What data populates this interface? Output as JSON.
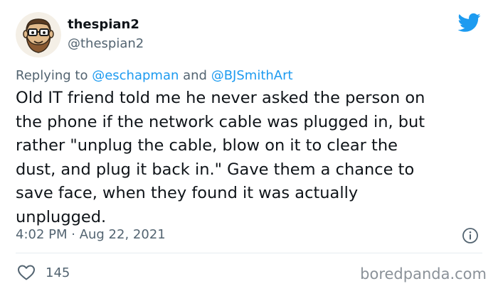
{
  "user": {
    "display_name": "thespian2",
    "handle": "@thespian2"
  },
  "reply": {
    "prefix": "Replying to ",
    "mention1": "@eschapman",
    "joiner": " and ",
    "mention2": "@BJSmithArt"
  },
  "tweet": {
    "text": "Old IT friend told me he never asked the person on\nthe phone if the network cable was plugged in, but\nrather \"unplug the cable, blow on it to clear the\ndust, and plug it back in.\" Gave them a chance to\nsave face, when they found it was actually\nunplugged."
  },
  "meta": {
    "timestamp": "4:02 PM · Aug 22, 2021"
  },
  "stats": {
    "likes": "145"
  },
  "watermark": "boredpanda.com",
  "icons": {
    "avatar": "cartoon-avatar-icon",
    "brand": "twitter-bird-icon",
    "info": "info-icon",
    "like": "heart-icon"
  },
  "colors": {
    "accent": "#1d9bf0",
    "secondary_text": "#536471",
    "primary_text": "#0f1419"
  }
}
